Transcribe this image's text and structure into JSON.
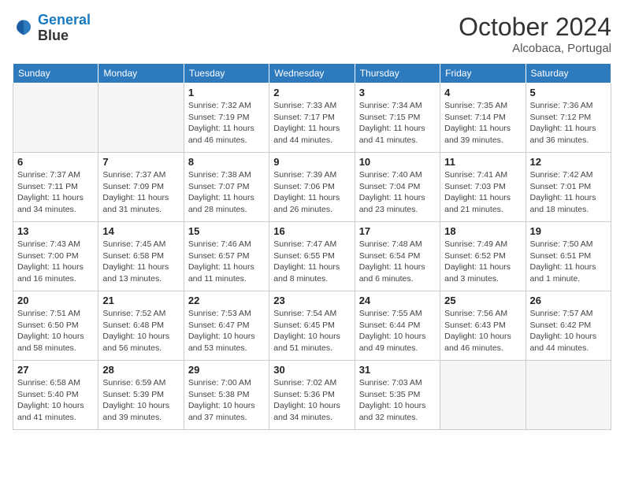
{
  "header": {
    "logo_line1": "General",
    "logo_line2": "Blue",
    "month": "October 2024",
    "location": "Alcobaca, Portugal"
  },
  "weekdays": [
    "Sunday",
    "Monday",
    "Tuesday",
    "Wednesday",
    "Thursday",
    "Friday",
    "Saturday"
  ],
  "weeks": [
    [
      {
        "day": "",
        "detail": ""
      },
      {
        "day": "",
        "detail": ""
      },
      {
        "day": "1",
        "detail": "Sunrise: 7:32 AM\nSunset: 7:19 PM\nDaylight: 11 hours and 46 minutes."
      },
      {
        "day": "2",
        "detail": "Sunrise: 7:33 AM\nSunset: 7:17 PM\nDaylight: 11 hours and 44 minutes."
      },
      {
        "day": "3",
        "detail": "Sunrise: 7:34 AM\nSunset: 7:15 PM\nDaylight: 11 hours and 41 minutes."
      },
      {
        "day": "4",
        "detail": "Sunrise: 7:35 AM\nSunset: 7:14 PM\nDaylight: 11 hours and 39 minutes."
      },
      {
        "day": "5",
        "detail": "Sunrise: 7:36 AM\nSunset: 7:12 PM\nDaylight: 11 hours and 36 minutes."
      }
    ],
    [
      {
        "day": "6",
        "detail": "Sunrise: 7:37 AM\nSunset: 7:11 PM\nDaylight: 11 hours and 34 minutes."
      },
      {
        "day": "7",
        "detail": "Sunrise: 7:37 AM\nSunset: 7:09 PM\nDaylight: 11 hours and 31 minutes."
      },
      {
        "day": "8",
        "detail": "Sunrise: 7:38 AM\nSunset: 7:07 PM\nDaylight: 11 hours and 28 minutes."
      },
      {
        "day": "9",
        "detail": "Sunrise: 7:39 AM\nSunset: 7:06 PM\nDaylight: 11 hours and 26 minutes."
      },
      {
        "day": "10",
        "detail": "Sunrise: 7:40 AM\nSunset: 7:04 PM\nDaylight: 11 hours and 23 minutes."
      },
      {
        "day": "11",
        "detail": "Sunrise: 7:41 AM\nSunset: 7:03 PM\nDaylight: 11 hours and 21 minutes."
      },
      {
        "day": "12",
        "detail": "Sunrise: 7:42 AM\nSunset: 7:01 PM\nDaylight: 11 hours and 18 minutes."
      }
    ],
    [
      {
        "day": "13",
        "detail": "Sunrise: 7:43 AM\nSunset: 7:00 PM\nDaylight: 11 hours and 16 minutes."
      },
      {
        "day": "14",
        "detail": "Sunrise: 7:45 AM\nSunset: 6:58 PM\nDaylight: 11 hours and 13 minutes."
      },
      {
        "day": "15",
        "detail": "Sunrise: 7:46 AM\nSunset: 6:57 PM\nDaylight: 11 hours and 11 minutes."
      },
      {
        "day": "16",
        "detail": "Sunrise: 7:47 AM\nSunset: 6:55 PM\nDaylight: 11 hours and 8 minutes."
      },
      {
        "day": "17",
        "detail": "Sunrise: 7:48 AM\nSunset: 6:54 PM\nDaylight: 11 hours and 6 minutes."
      },
      {
        "day": "18",
        "detail": "Sunrise: 7:49 AM\nSunset: 6:52 PM\nDaylight: 11 hours and 3 minutes."
      },
      {
        "day": "19",
        "detail": "Sunrise: 7:50 AM\nSunset: 6:51 PM\nDaylight: 11 hours and 1 minute."
      }
    ],
    [
      {
        "day": "20",
        "detail": "Sunrise: 7:51 AM\nSunset: 6:50 PM\nDaylight: 10 hours and 58 minutes."
      },
      {
        "day": "21",
        "detail": "Sunrise: 7:52 AM\nSunset: 6:48 PM\nDaylight: 10 hours and 56 minutes."
      },
      {
        "day": "22",
        "detail": "Sunrise: 7:53 AM\nSunset: 6:47 PM\nDaylight: 10 hours and 53 minutes."
      },
      {
        "day": "23",
        "detail": "Sunrise: 7:54 AM\nSunset: 6:45 PM\nDaylight: 10 hours and 51 minutes."
      },
      {
        "day": "24",
        "detail": "Sunrise: 7:55 AM\nSunset: 6:44 PM\nDaylight: 10 hours and 49 minutes."
      },
      {
        "day": "25",
        "detail": "Sunrise: 7:56 AM\nSunset: 6:43 PM\nDaylight: 10 hours and 46 minutes."
      },
      {
        "day": "26",
        "detail": "Sunrise: 7:57 AM\nSunset: 6:42 PM\nDaylight: 10 hours and 44 minutes."
      }
    ],
    [
      {
        "day": "27",
        "detail": "Sunrise: 6:58 AM\nSunset: 5:40 PM\nDaylight: 10 hours and 41 minutes."
      },
      {
        "day": "28",
        "detail": "Sunrise: 6:59 AM\nSunset: 5:39 PM\nDaylight: 10 hours and 39 minutes."
      },
      {
        "day": "29",
        "detail": "Sunrise: 7:00 AM\nSunset: 5:38 PM\nDaylight: 10 hours and 37 minutes."
      },
      {
        "day": "30",
        "detail": "Sunrise: 7:02 AM\nSunset: 5:36 PM\nDaylight: 10 hours and 34 minutes."
      },
      {
        "day": "31",
        "detail": "Sunrise: 7:03 AM\nSunset: 5:35 PM\nDaylight: 10 hours and 32 minutes."
      },
      {
        "day": "",
        "detail": ""
      },
      {
        "day": "",
        "detail": ""
      }
    ]
  ]
}
